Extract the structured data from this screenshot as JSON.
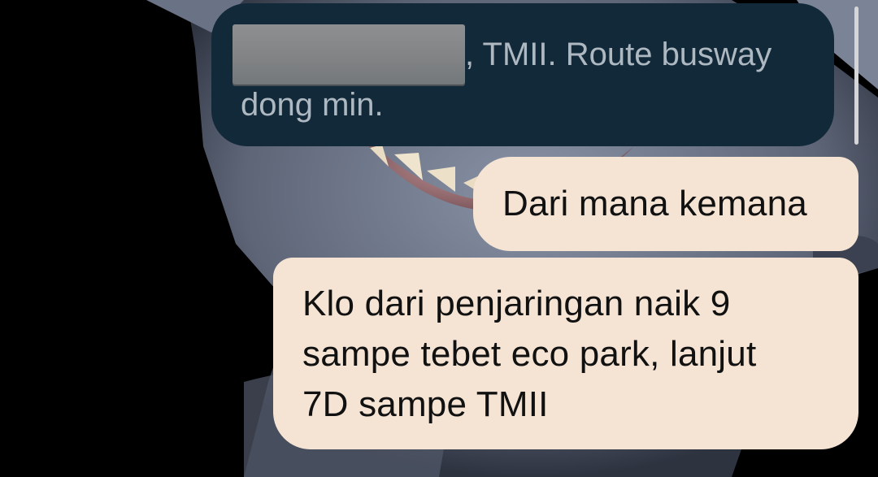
{
  "messages": [
    {
      "direction": "incoming",
      "line1_suffix": ", TMII. Route busway",
      "line2": "dong min.",
      "redacted": true
    },
    {
      "direction": "outgoing",
      "text": "Dari mana kemana"
    },
    {
      "direction": "outgoing",
      "lines": [
        "Klo dari penjaringan naik 9",
        "sampe tebet eco park, lanjut",
        "7D sampe TMII"
      ]
    }
  ],
  "colors": {
    "incoming_bubble": "#12293a",
    "incoming_text": "#aeb8c1",
    "outgoing_bubble": "#f5e4d4",
    "outgoing_text": "#111111",
    "background": "#000000"
  }
}
